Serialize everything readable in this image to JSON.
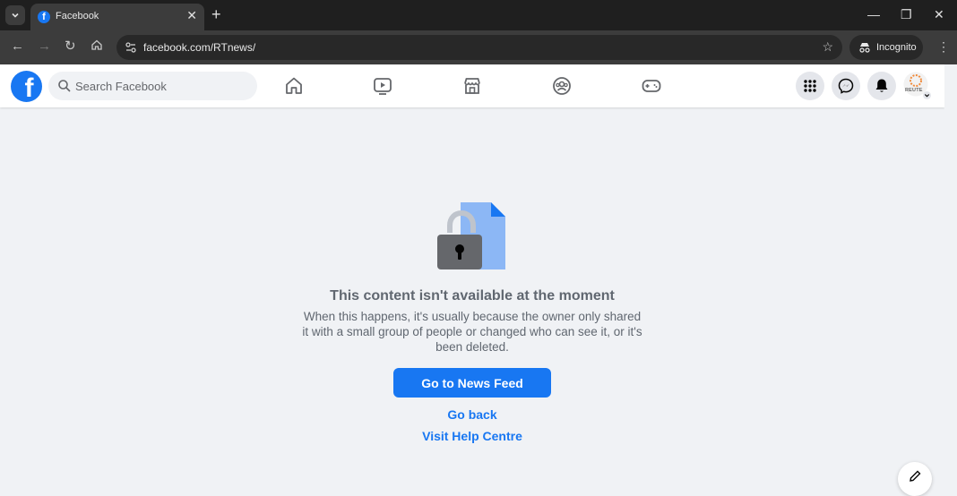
{
  "browser": {
    "tab": {
      "title": "Facebook"
    },
    "url": "facebook.com/RTnews/",
    "incognito_label": "Incognito"
  },
  "header": {
    "search_placeholder": "Search Facebook",
    "avatar_text": "REUTE"
  },
  "message": {
    "title": "This content isn't available at the moment",
    "body": "When this happens, it's usually because the owner only shared it with a small group of people or changed who can see it, or it's been deleted."
  },
  "actions": {
    "primary": "Go to News Feed",
    "back": "Go back",
    "help": "Visit Help Centre"
  },
  "colors": {
    "brand": "#1877f2",
    "background": "#f0f2f5",
    "text_muted": "#606770"
  },
  "icons": [
    "facebook-logo-icon",
    "search-icon",
    "home-icon",
    "video-icon",
    "marketplace-icon",
    "groups-icon",
    "gaming-icon",
    "menu-grid-icon",
    "messenger-icon",
    "bell-icon",
    "lock-icon",
    "compose-icon"
  ]
}
